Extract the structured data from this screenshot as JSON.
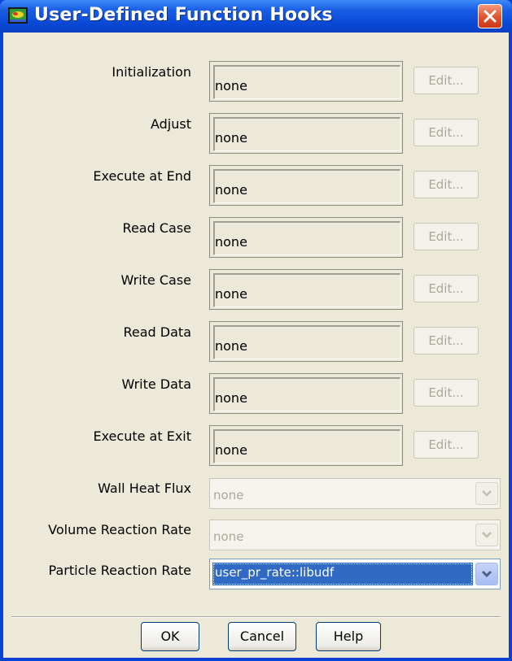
{
  "window": {
    "title": "User-Defined Function Hooks"
  },
  "icons": {
    "app": "fluent-app-icon",
    "close": "close-icon",
    "dropdown": "chevron-down-icon"
  },
  "hooks": [
    {
      "label": "Initialization",
      "value": "none",
      "edit_label": "Edit..."
    },
    {
      "label": "Adjust",
      "value": "none",
      "edit_label": "Edit..."
    },
    {
      "label": "Execute at End",
      "value": "none",
      "edit_label": "Edit..."
    },
    {
      "label": "Read Case",
      "value": "none",
      "edit_label": "Edit..."
    },
    {
      "label": "Write Case",
      "value": "none",
      "edit_label": "Edit..."
    },
    {
      "label": "Read Data",
      "value": "none",
      "edit_label": "Edit..."
    },
    {
      "label": "Write Data",
      "value": "none",
      "edit_label": "Edit..."
    },
    {
      "label": "Execute at Exit",
      "value": "none",
      "edit_label": "Edit..."
    }
  ],
  "dropdowns": [
    {
      "label": "Wall Heat Flux",
      "value": "none",
      "enabled": false
    },
    {
      "label": "Volume Reaction Rate",
      "value": "none",
      "enabled": false
    },
    {
      "label": "Particle Reaction Rate",
      "value": "user_pr_rate::libudf",
      "enabled": true
    }
  ],
  "buttons": {
    "ok": "OK",
    "cancel": "Cancel",
    "help": "Help"
  },
  "colors": {
    "titlebar": "#0a4ad6",
    "dialog_bg": "#ece9d8",
    "selection": "#316ac5",
    "close": "#e0522b"
  }
}
